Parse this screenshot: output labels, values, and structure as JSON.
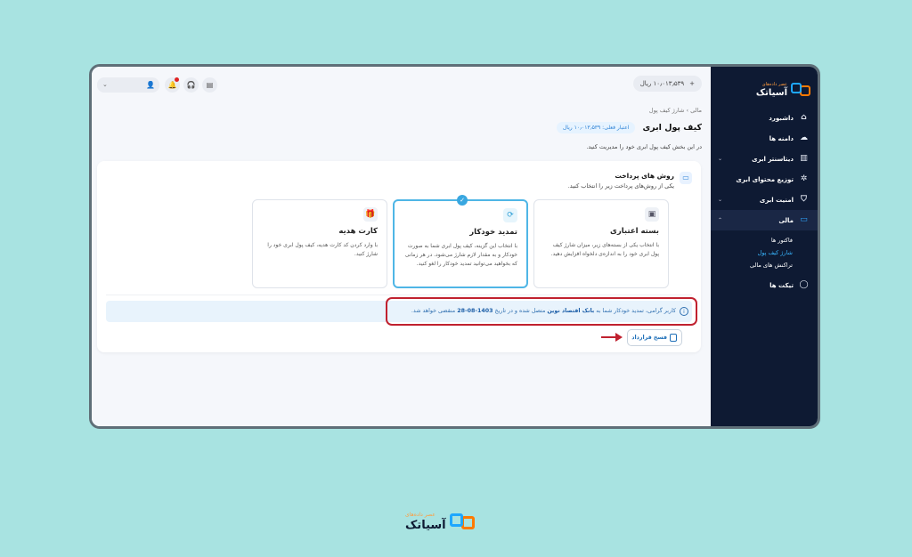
{
  "brand": {
    "name": "آسیاتک",
    "tagline": "عصر داده‌های"
  },
  "sidebar": {
    "items": [
      {
        "label": "داشبورد",
        "icon": "home-icon"
      },
      {
        "label": "دامنه ها",
        "icon": "cloud-upload-icon"
      },
      {
        "label": "دیتاسنتر ابری",
        "icon": "server-icon"
      },
      {
        "label": "توزیع محتوای ابری",
        "icon": "network-icon"
      },
      {
        "label": "امنیت ابری",
        "icon": "shield-icon"
      },
      {
        "label": "مالی",
        "icon": "wallet-icon"
      },
      {
        "label": "تیکت ها",
        "icon": "chat-icon"
      }
    ],
    "finance_sub": [
      "فاکتور ها",
      "شارژ کیف پول",
      "تراکنش های مالی"
    ]
  },
  "topbar": {
    "balance": "۱۰٫۰۱۳٫۵۳۹ ریال",
    "plus": "+"
  },
  "breadcrumb": {
    "parent": "مالی",
    "sep": "›",
    "current": "شارژ کیف پول"
  },
  "page": {
    "title": "کیف پول ابری",
    "credit": "اعتبار فعلی: ۱۰٫۰۱۳٫۵۳۹ ریال",
    "description": "در این بخش کیف پول ابری خود را مدیریت کنید."
  },
  "payment": {
    "title": "روش های پرداخت",
    "subtitle": "یکی از روش‌های پرداخت زیر را انتخاب کنید.",
    "options": [
      {
        "title": "بسته اعتباری",
        "desc": "با انتخاب یکی از بسته‌های زیر، میزان شارژ کیف پول ابری خود را به اندازه‌ی دلخواه افزایش دهید."
      },
      {
        "title": "تمدید خودکار",
        "desc": "با انتخاب این گزینه، کیف پول ابری شما به صورت خودکار و به مقدار لازم شارژ می‌شود. در هر زمانی که بخواهید می‌توانید تمدید خودکار را لغو کنید."
      },
      {
        "title": "کارت هدیه",
        "desc": "با وارد کردن کد کارت هدیه، کیف پول ابری خود را شارژ کنید."
      }
    ]
  },
  "notice": {
    "part1": "کاربر گرامی، تمدید خودکار شما به",
    "bank": "بانک اقتصاد نوین",
    "part2": "متصل شده و در تاریخ",
    "date": "1403-08-28",
    "part3": "منقضی خواهد شد."
  },
  "cancel_label": "فسخ قرارداد"
}
